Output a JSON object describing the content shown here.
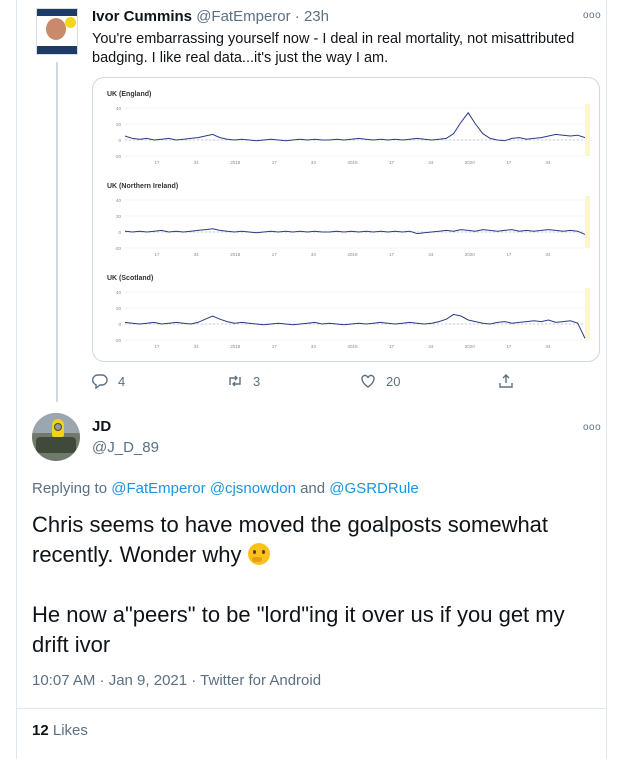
{
  "tweet1": {
    "display_name": "Ivor Cummins",
    "handle": "@FatEmperor",
    "time": "23h",
    "text": "You're embarrassing yourself now - I deal in real mortality, not misattributed badging.  I like real data...it's just the way I am.",
    "stats": {
      "replies": "4",
      "retweets": "3",
      "likes": "20"
    }
  },
  "tweet2": {
    "display_name": "JD",
    "handle": "@J_D_89",
    "replying_prefix": "Replying to",
    "mentions": [
      "@FatEmperor",
      "@cjsnowdon",
      "@GSRDRule"
    ],
    "replying_and": "and",
    "paragraph1": "Chris seems to have moved the goalposts somewhat recently. Wonder why",
    "paragraph2": "He now a\"peers\" to be \"lord\"ing it over us if you get my drift ivor",
    "timestamp": "10:07 AM · Jan 9, 2021 · Twitter for Android",
    "likes_count": "12",
    "likes_label": "Likes"
  },
  "chart_data": [
    {
      "type": "line",
      "title": "UK (England)",
      "yticks": [
        "40",
        "20",
        "0",
        "-20"
      ],
      "ylim": [
        -20,
        40
      ],
      "xticks": [
        "17",
        "34",
        "2018",
        "17",
        "34",
        "2019",
        "17",
        "34",
        "2020",
        "17",
        "34"
      ],
      "series": [
        {
          "values": [
            5,
            2,
            1,
            2,
            0,
            1,
            2,
            0,
            1,
            2,
            3,
            5,
            7,
            3,
            1,
            0,
            1,
            0,
            -1,
            0,
            1,
            0,
            -1,
            0,
            1,
            0,
            1,
            0,
            0,
            1,
            0,
            1,
            2,
            1,
            0,
            1,
            0,
            1,
            0,
            1,
            2,
            1,
            0,
            1,
            2,
            8,
            22,
            34,
            20,
            8,
            2,
            0,
            -1,
            2,
            3,
            1,
            2,
            3,
            5,
            7,
            6,
            5,
            6,
            3
          ]
        }
      ]
    },
    {
      "type": "line",
      "title": "UK (Northern Ireland)",
      "yticks": [
        "40",
        "20",
        "0",
        "-20"
      ],
      "ylim": [
        -20,
        40
      ],
      "xticks": [
        "17",
        "34",
        "2018",
        "17",
        "34",
        "2019",
        "17",
        "34",
        "2020",
        "17",
        "34"
      ],
      "series": [
        {
          "values": [
            1,
            0,
            1,
            0,
            1,
            2,
            0,
            1,
            0,
            1,
            2,
            3,
            4,
            2,
            1,
            0,
            1,
            0,
            -1,
            0,
            1,
            0,
            1,
            0,
            1,
            0,
            1,
            0,
            0,
            1,
            0,
            1,
            0,
            1,
            0,
            1,
            0,
            1,
            0,
            1,
            -2,
            -1,
            0,
            1,
            2,
            1,
            3,
            2,
            1,
            3,
            2,
            1,
            2,
            3,
            1,
            2,
            1,
            2,
            3,
            2,
            1,
            2,
            1,
            -3
          ]
        }
      ]
    },
    {
      "type": "line",
      "title": "UK (Scotland)",
      "yticks": [
        "40",
        "20",
        "0",
        "-20"
      ],
      "ylim": [
        -20,
        40
      ],
      "xticks": [
        "17",
        "34",
        "2018",
        "17",
        "34",
        "2019",
        "17",
        "34",
        "2020",
        "17",
        "34"
      ],
      "series": [
        {
          "values": [
            2,
            1,
            0,
            1,
            2,
            0,
            1,
            2,
            1,
            0,
            2,
            6,
            10,
            6,
            3,
            1,
            2,
            1,
            0,
            -1,
            0,
            1,
            0,
            -1,
            0,
            1,
            2,
            0,
            1,
            0,
            -1,
            0,
            1,
            0,
            1,
            2,
            1,
            0,
            1,
            2,
            1,
            0,
            1,
            3,
            6,
            12,
            10,
            5,
            3,
            1,
            0,
            2,
            3,
            1,
            2,
            3,
            4,
            3,
            5,
            2,
            3,
            4,
            1,
            -18
          ]
        }
      ]
    }
  ],
  "colors": {
    "line": "#2c3a87",
    "accent": "#1b95e0",
    "muted": "#5b7083"
  },
  "icons": [
    "reply-icon",
    "retweet-icon",
    "like-icon",
    "share-icon",
    "more-icon"
  ]
}
